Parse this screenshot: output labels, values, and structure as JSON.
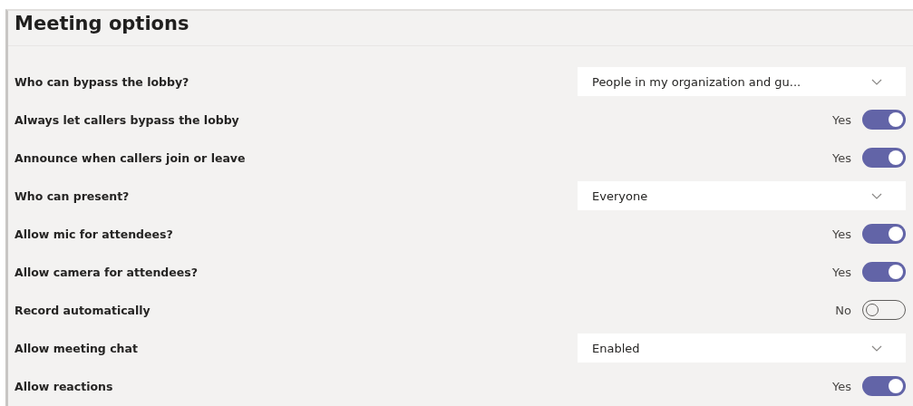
{
  "title": "Meeting options",
  "options": [
    {
      "kind": "dropdown",
      "label": "Who can bypass the lobby?",
      "value": "People in my organization and gu..."
    },
    {
      "kind": "toggle",
      "label": "Always let callers bypass the lobby",
      "state_text": "Yes",
      "on": true
    },
    {
      "kind": "toggle",
      "label": "Announce when callers join or leave",
      "state_text": "Yes",
      "on": true
    },
    {
      "kind": "dropdown",
      "label": "Who can present?",
      "value": "Everyone"
    },
    {
      "kind": "toggle",
      "label": "Allow mic for attendees?",
      "state_text": "Yes",
      "on": true
    },
    {
      "kind": "toggle",
      "label": "Allow camera for attendees?",
      "state_text": "Yes",
      "on": true
    },
    {
      "kind": "toggle",
      "label": "Record automatically",
      "state_text": "No",
      "on": false
    },
    {
      "kind": "dropdown",
      "label": "Allow meeting chat",
      "value": "Enabled"
    },
    {
      "kind": "toggle",
      "label": "Allow reactions",
      "state_text": "Yes",
      "on": true
    }
  ]
}
